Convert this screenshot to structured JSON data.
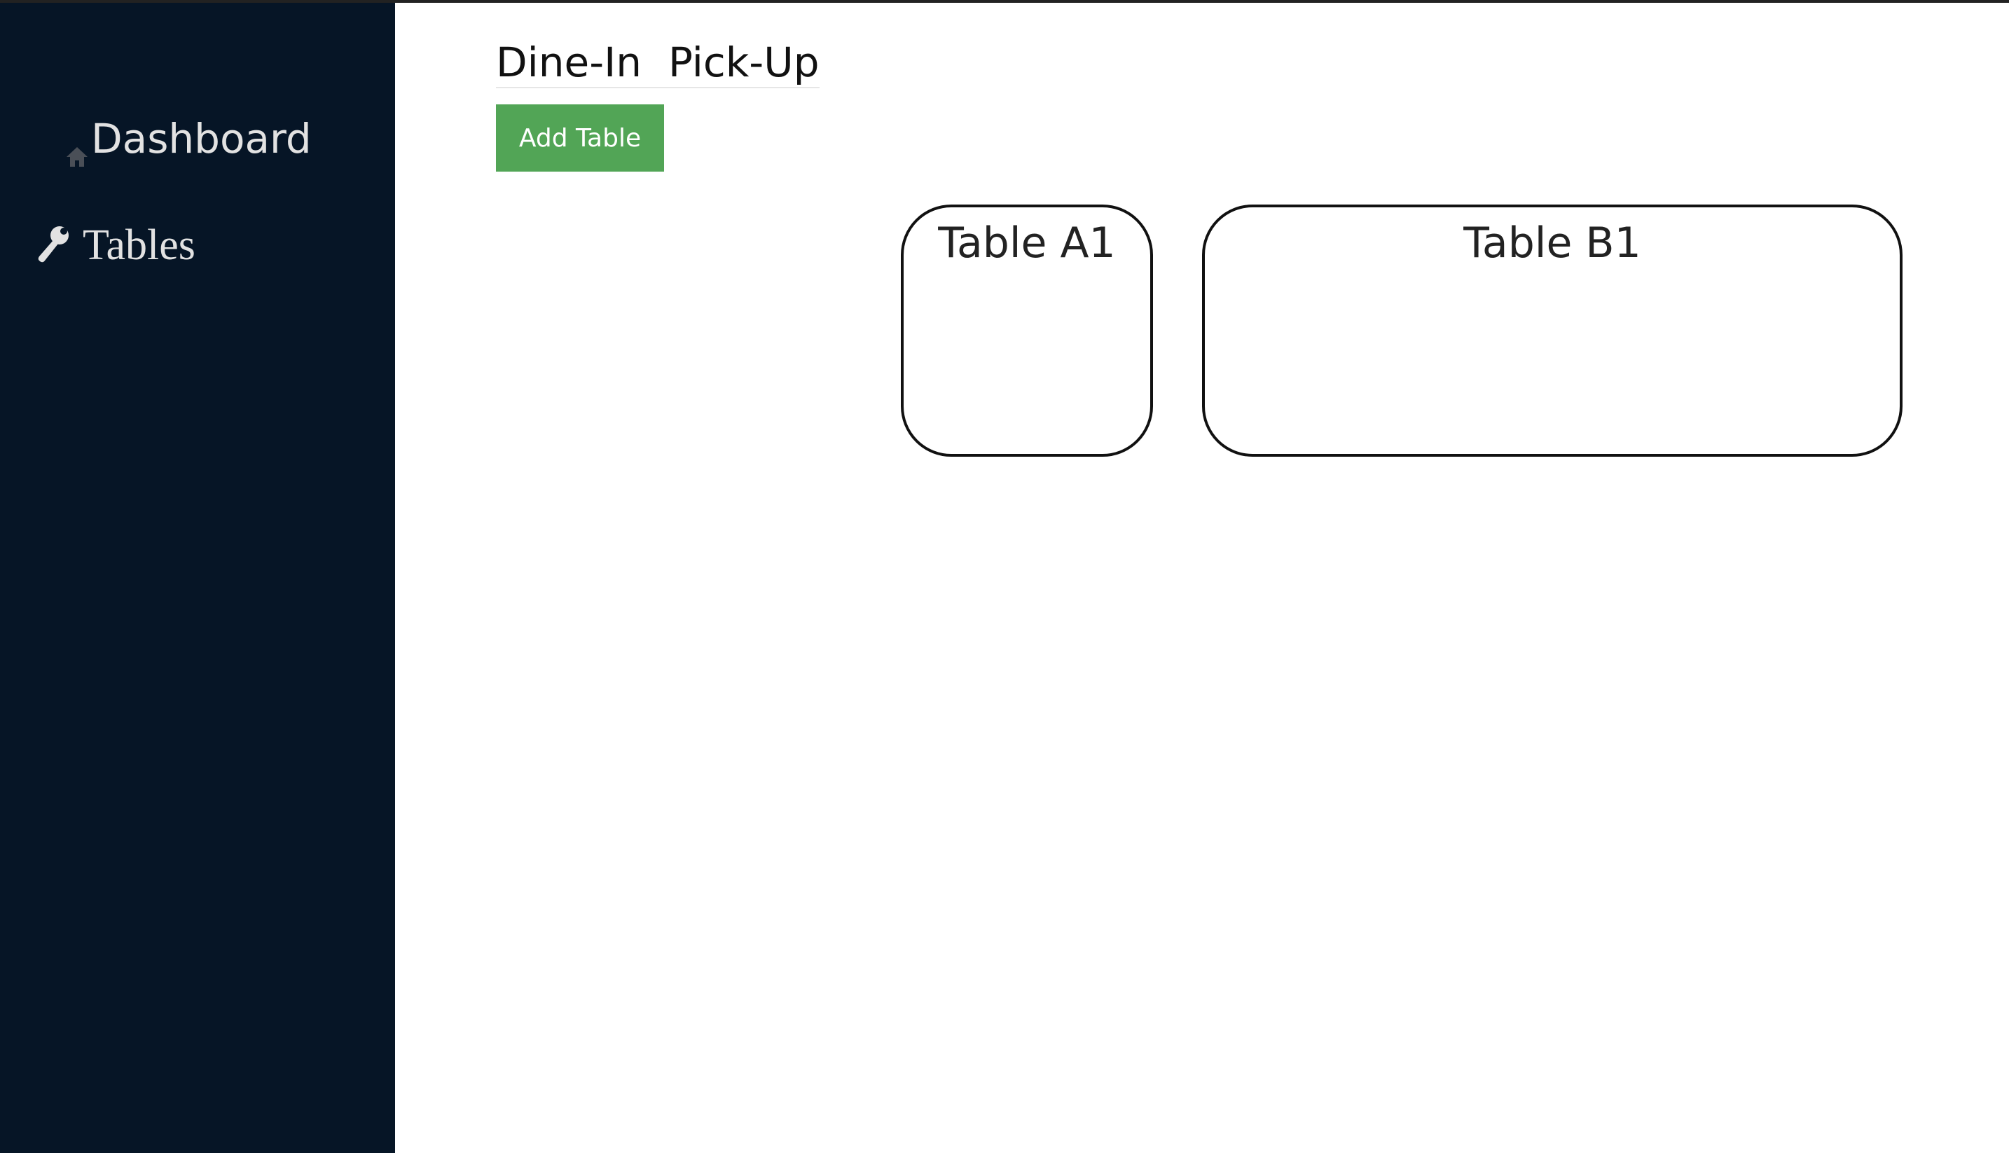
{
  "sidebar": {
    "background_color": "#061526",
    "items": [
      {
        "label": "Dashboard",
        "icon": "home-icon"
      },
      {
        "label": "Tables",
        "icon": "wrench-icon"
      }
    ]
  },
  "main": {
    "tabs": [
      {
        "label": "Dine-In"
      },
      {
        "label": "Pick-Up"
      }
    ],
    "add_table_button": {
      "label": "Add Table",
      "color": "#52a556"
    },
    "tables": [
      {
        "label": "Table A1"
      },
      {
        "label": "Table B1"
      }
    ]
  }
}
